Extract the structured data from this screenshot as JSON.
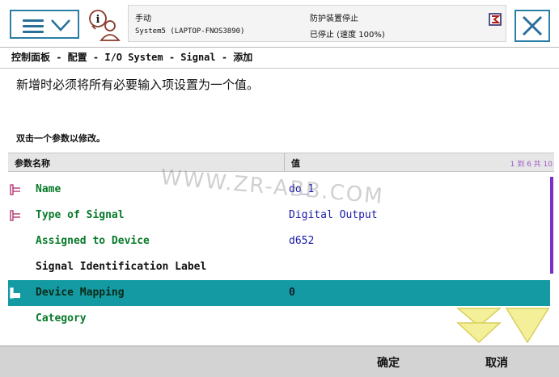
{
  "status": {
    "mode": "手动",
    "system": "System5 (LAPTOP-FNOS3890)",
    "safety": "防护装置停止",
    "state": "已停止 (速度 100%)"
  },
  "breadcrumb": "控制面板 - 配置 - I/O System - Signal - 添加",
  "instruction": "新增时必须将所有必要输入项设置为一个值。",
  "hint": "双击一个参数以修改。",
  "table": {
    "header_name": "参数名称",
    "header_value": "值",
    "page_info": "1 到 6 共 10",
    "rows": [
      {
        "name": "Name",
        "value": "do_1",
        "icon": "required-param-icon",
        "selected": false
      },
      {
        "name": "Type of Signal",
        "value": "Digital Output",
        "icon": "required-param-icon",
        "selected": false
      },
      {
        "name": "Assigned to Device",
        "value": "d652",
        "icon": "",
        "selected": false
      },
      {
        "name": "Signal Identification Label",
        "value": "",
        "icon": "",
        "selected": false
      },
      {
        "name": "Device Mapping",
        "value": "0",
        "icon": "edit-param-icon",
        "selected": true
      },
      {
        "name": "Category",
        "value": "",
        "icon": "",
        "selected": false
      }
    ]
  },
  "buttons": {
    "ok": "确定",
    "cancel": "取消"
  },
  "watermark": "WWW.ZR-ABB.COM",
  "colors": {
    "accent": "#2b7fa6",
    "selected_row": "#139aa3",
    "param_name": "#087a2a",
    "param_value": "#1a1aa8",
    "scroll_arrow": "#f4f09a"
  }
}
